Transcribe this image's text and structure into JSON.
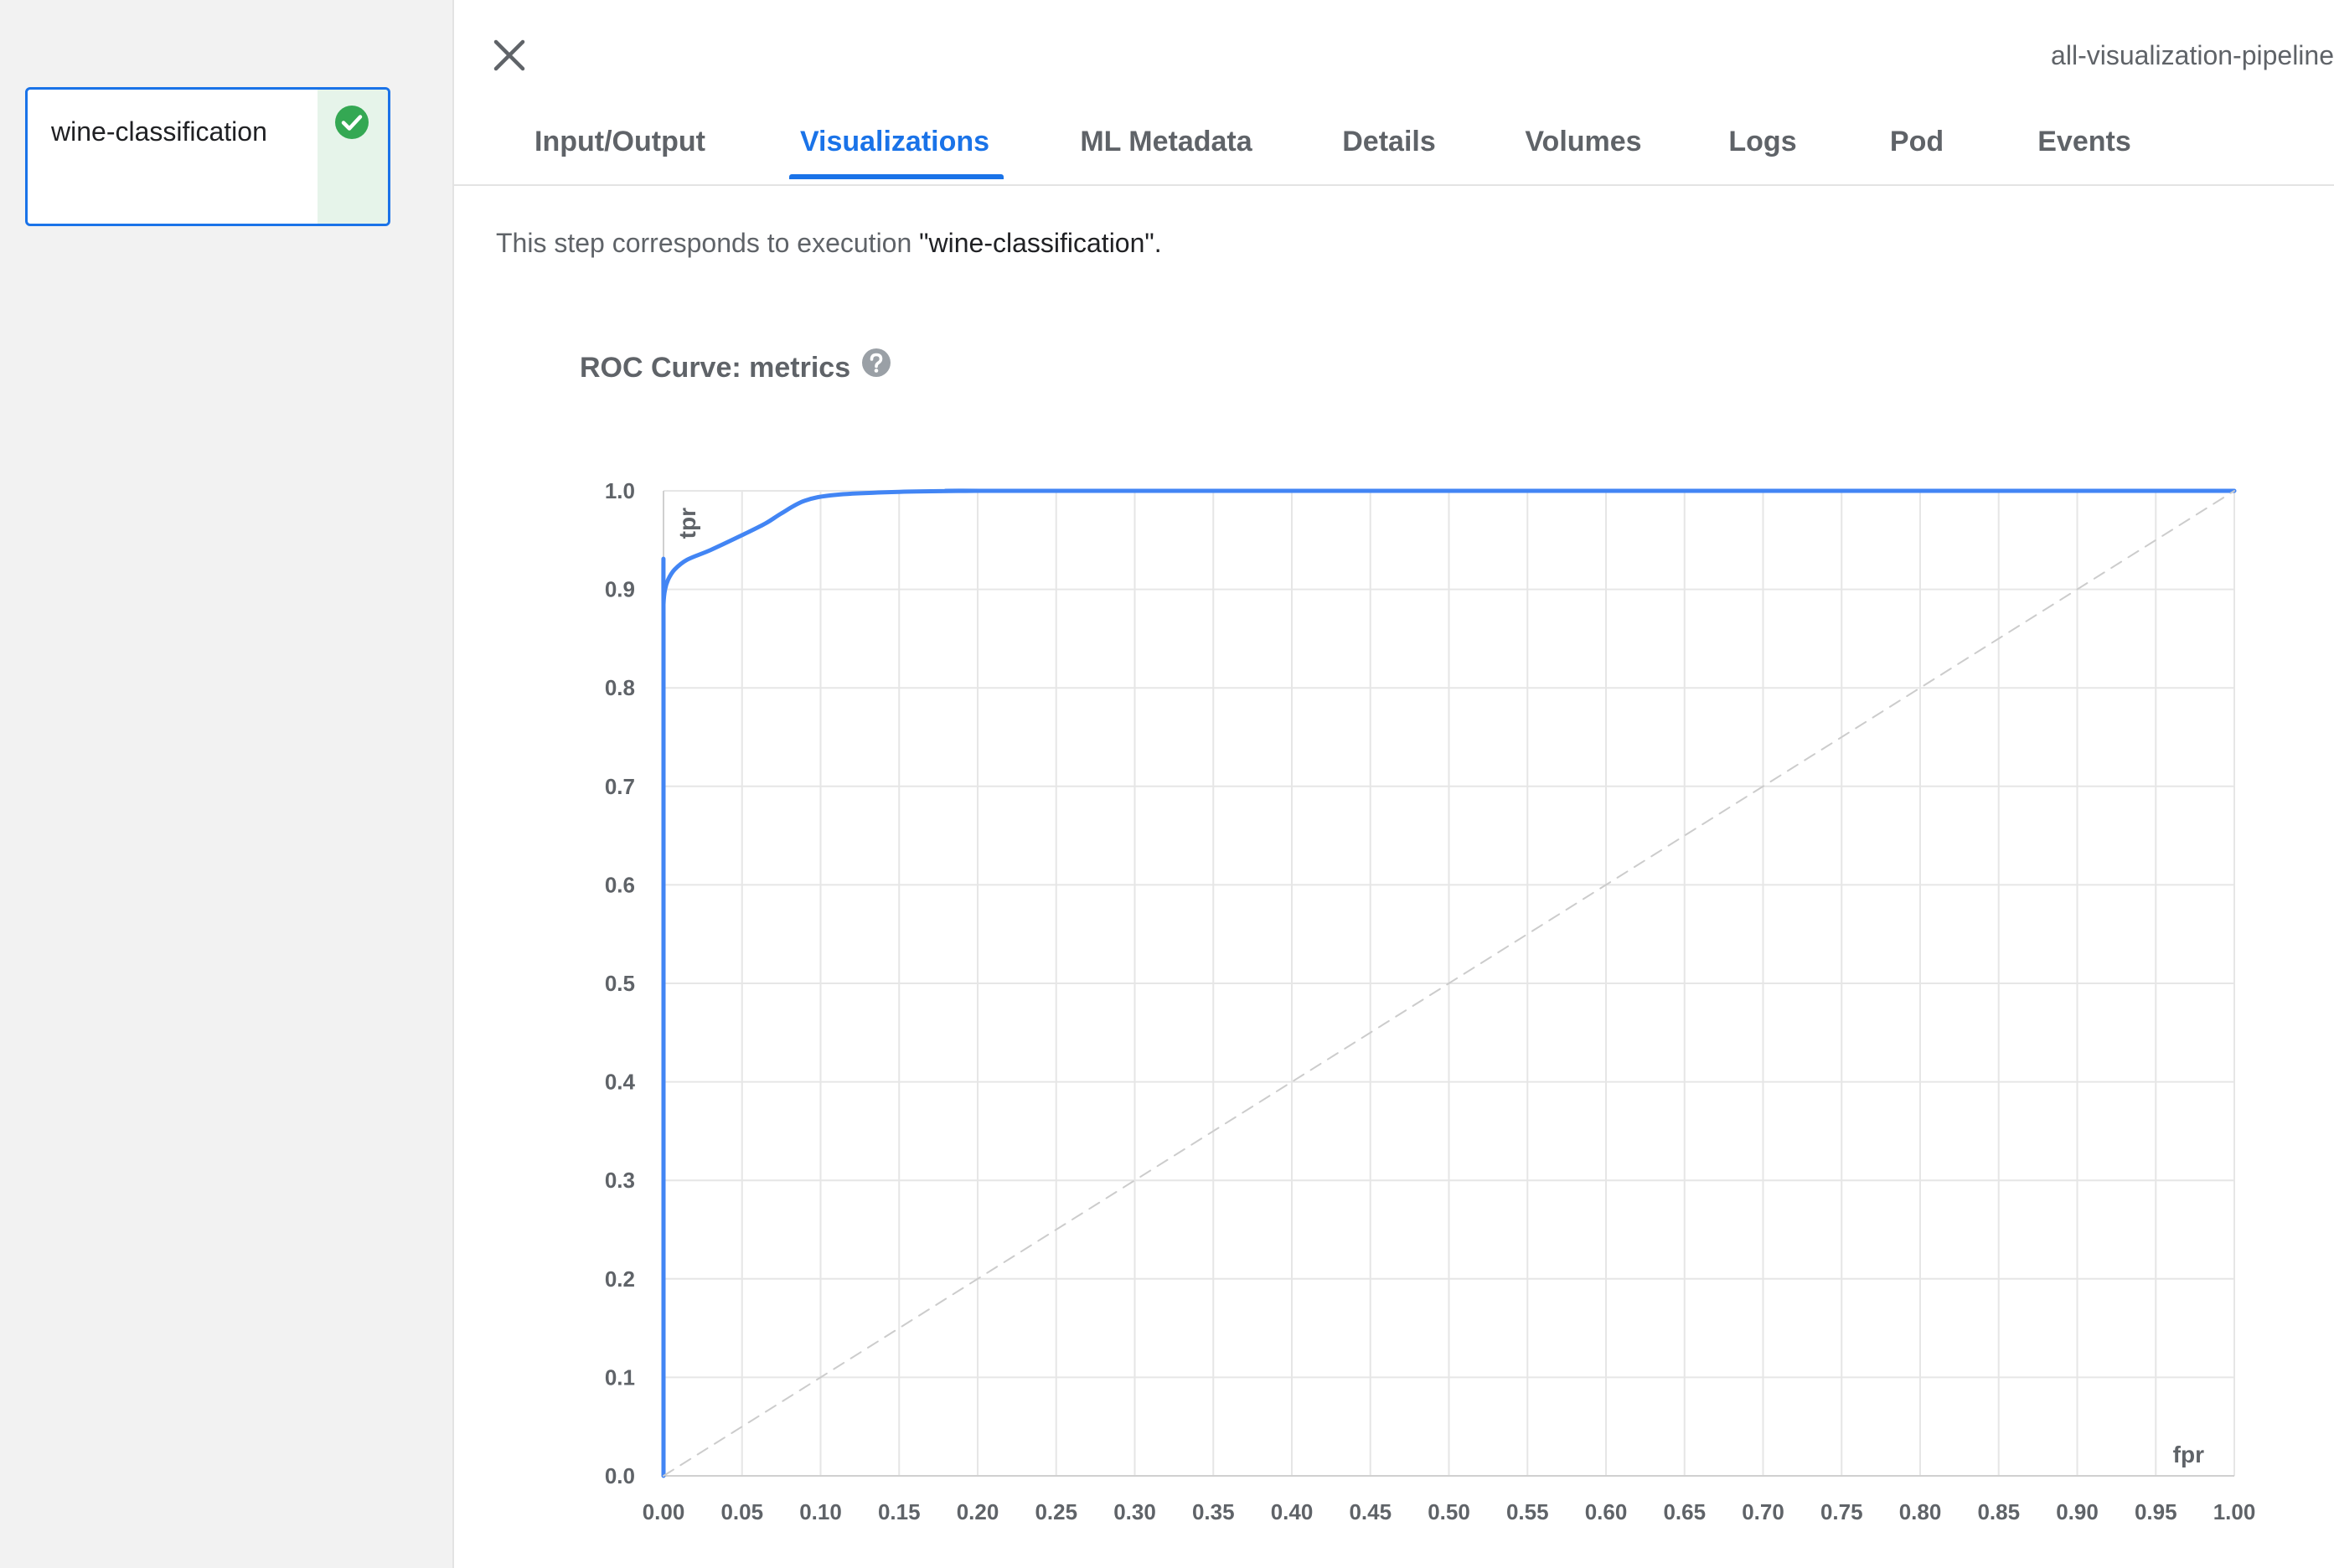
{
  "graph": {
    "node": {
      "label": "wine-classification",
      "status": "success",
      "status_icon": "check-circle-icon",
      "status_color": "#34a853"
    }
  },
  "panel": {
    "run_name": "all-visualization-pipeline",
    "close_icon": "close-icon",
    "tabs": [
      {
        "label": "Input/Output",
        "active": false
      },
      {
        "label": "Visualizations",
        "active": true
      },
      {
        "label": "ML Metadata",
        "active": false
      },
      {
        "label": "Details",
        "active": false
      },
      {
        "label": "Volumes",
        "active": false
      },
      {
        "label": "Logs",
        "active": false
      },
      {
        "label": "Pod",
        "active": false
      },
      {
        "label": "Events",
        "active": false
      }
    ],
    "execution_prefix": "This step corresponds to execution ",
    "execution_name": "\"wine-classification\".",
    "accent_color": "#1a73e8"
  },
  "visualization": {
    "title": "ROC Curve: metrics",
    "help_icon": "help-icon"
  },
  "chart_data": {
    "type": "line",
    "title": "ROC Curve: metrics",
    "xlabel": "fpr",
    "ylabel": "tpr",
    "xlim": [
      0,
      1
    ],
    "ylim": [
      0,
      1
    ],
    "grid": true,
    "x_ticks": [
      "0.00",
      "0.05",
      "0.10",
      "0.15",
      "0.20",
      "0.25",
      "0.30",
      "0.35",
      "0.40",
      "0.45",
      "0.50",
      "0.55",
      "0.60",
      "0.65",
      "0.70",
      "0.75",
      "0.80",
      "0.85",
      "0.90",
      "0.95",
      "1.00"
    ],
    "y_ticks": [
      "0.0",
      "0.1",
      "0.2",
      "0.3",
      "0.4",
      "0.5",
      "0.6",
      "0.7",
      "0.8",
      "0.9",
      "1.0"
    ],
    "series": [
      {
        "color": "#4285f4",
        "x": [
          0,
          0,
          0,
          0.001,
          0.003,
          0.007,
          0.015,
          0.03,
          0.05,
          0.065,
          0.075,
          0.09,
          0.11,
          0.15,
          0.2,
          0.25,
          1.0
        ],
        "y": [
          0,
          0.86,
          0.885,
          0.9,
          0.91,
          0.92,
          0.93,
          0.94,
          0.955,
          0.967,
          0.977,
          0.99,
          0.996,
          0.999,
          1.0,
          1.0,
          1.0
        ]
      },
      {
        "color": "#cccccc",
        "dashed": true,
        "x": [
          0,
          1
        ],
        "y": [
          0,
          1
        ]
      }
    ]
  }
}
